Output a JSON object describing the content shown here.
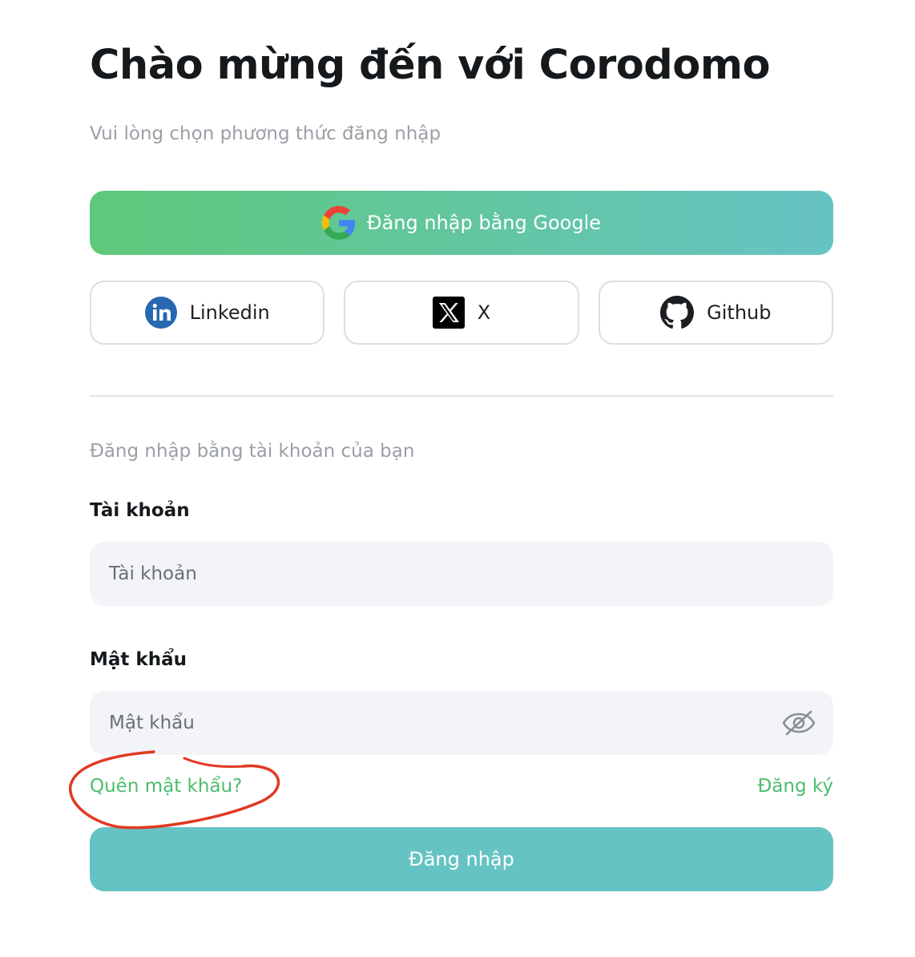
{
  "header": {
    "title": "Chào mừng đến với Corodomo",
    "subtitle": "Vui lòng chọn phương thức đăng nhập"
  },
  "social": {
    "google": {
      "label": "Đăng nhập bằng Google",
      "icon": "google-icon"
    },
    "linkedin": {
      "label": "Linkedin",
      "icon": "linkedin-icon",
      "color": "#2867b2"
    },
    "x": {
      "label": "X",
      "icon": "x-icon"
    },
    "github": {
      "label": "Github",
      "icon": "github-icon"
    }
  },
  "account_section": {
    "label": "Đăng nhập bằng tài khoản của bạn",
    "username": {
      "label": "Tài khoản",
      "placeholder": "Tài khoản",
      "value": ""
    },
    "password": {
      "label": "Mật khẩu",
      "placeholder": "Mật khẩu",
      "value": "",
      "toggle_icon": "eye-off-icon"
    }
  },
  "links": {
    "forgot_password": "Quên mật khẩu?",
    "register": "Đăng ký"
  },
  "submit": {
    "label": "Đăng nhập"
  },
  "colors": {
    "accent_green": "#4cbd6b",
    "gradient_start": "#5ec97a",
    "gradient_end": "#66c3c4",
    "button_teal": "#66c3c4",
    "annotation_red": "#e03a22"
  }
}
